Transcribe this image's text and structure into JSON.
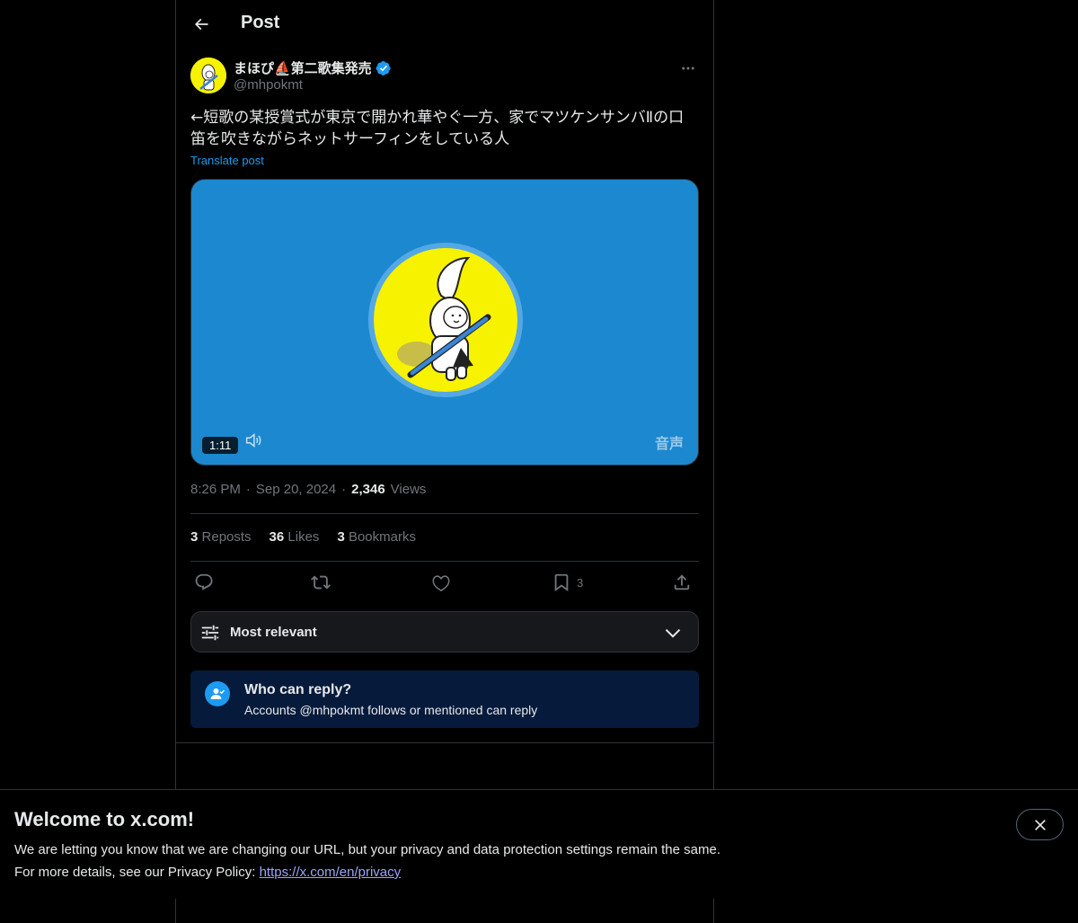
{
  "header": {
    "title": "Post",
    "back_icon": "arrow-left-icon"
  },
  "author": {
    "display_name": "まほぴ⛵第二歌集発売",
    "handle": "@mhpokmt",
    "verified": true,
    "accent_color": "#1d9bf0"
  },
  "post": {
    "text": "←短歌の某授賞式が東京で開かれ華やぐ一方、家でマツケンサンバⅡの口笛を吹きながらネットサーフィンをしている人",
    "translate_label": "Translate post",
    "media": {
      "duration": "1:11",
      "audio_label": "音声",
      "background_color": "#1c88d0"
    },
    "time": "8:26 PM",
    "date": "Sep 20, 2024",
    "views_count": "2,346",
    "views_label": "Views"
  },
  "stats": {
    "reposts_count": "3",
    "reposts_label": "Reposts",
    "likes_count": "36",
    "likes_label": "Likes",
    "bookmarks_count": "3",
    "bookmarks_label": "Bookmarks"
  },
  "actions": {
    "bookmark_count": "3"
  },
  "sort": {
    "label": "Most relevant"
  },
  "reply_restriction": {
    "title": "Who can reply?",
    "subtitle": "Accounts @mhpokmt follows or mentioned can reply"
  },
  "banner": {
    "title": "Welcome to x.com!",
    "line1": "We are letting you know that we are changing our URL, but your privacy and data protection settings remain the same.",
    "line2_prefix": "For more details, see our Privacy Policy: ",
    "link_text": "https://x.com/en/privacy"
  }
}
